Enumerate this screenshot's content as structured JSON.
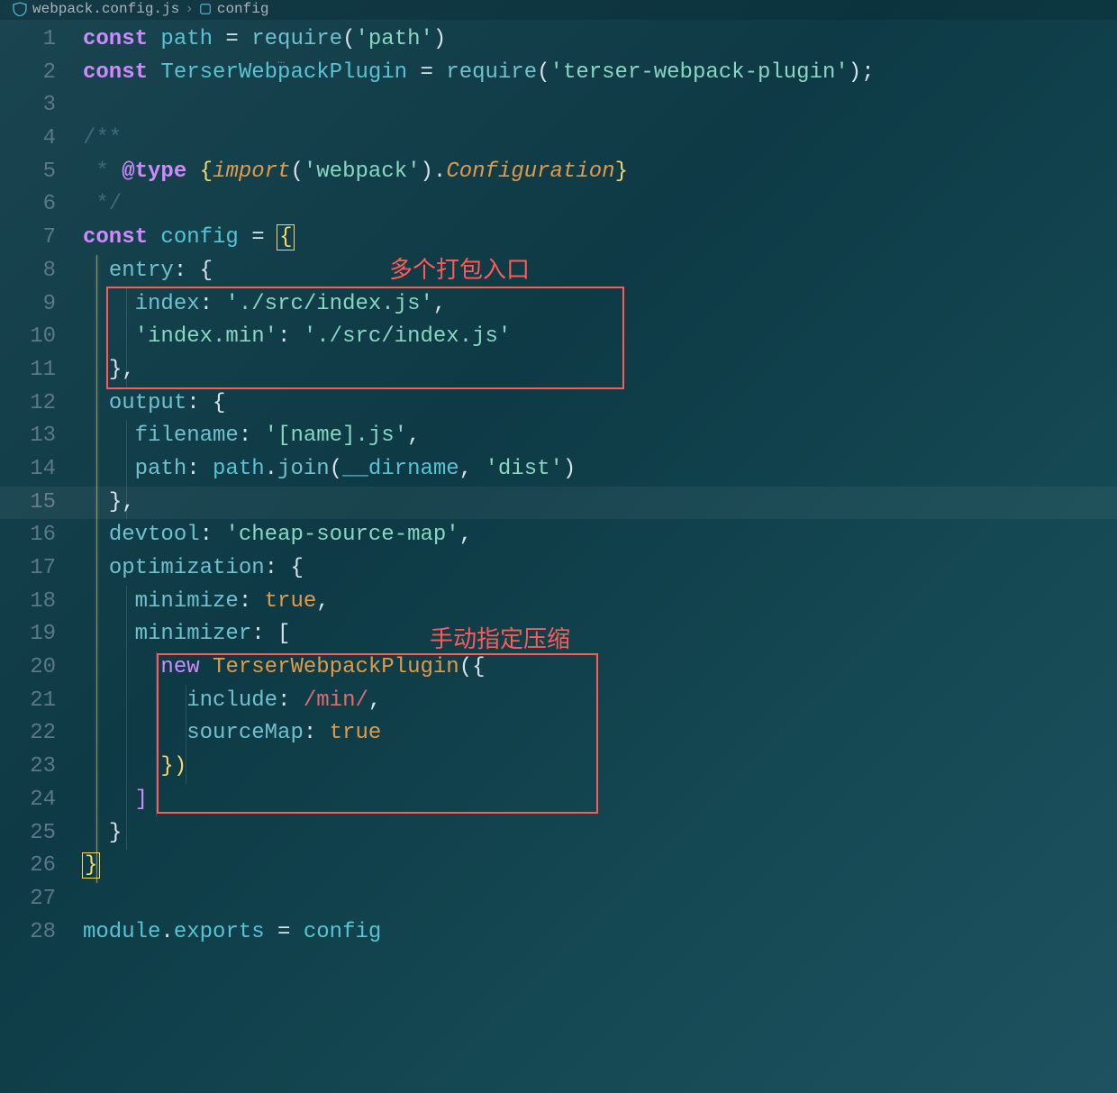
{
  "breadcrumb": {
    "file": "webpack.config.js",
    "symbol": "config"
  },
  "annotations": {
    "label1": "多个打包入口",
    "label2": "手动指定压缩"
  },
  "lineNumbers": [
    "1",
    "2",
    "3",
    "4",
    "5",
    "6",
    "7",
    "8",
    "9",
    "10",
    "11",
    "12",
    "13",
    "14",
    "15",
    "16",
    "17",
    "18",
    "19",
    "20",
    "21",
    "22",
    "23",
    "24",
    "25",
    "26",
    "27",
    "28"
  ],
  "tokens": {
    "const": "const",
    "path": "path",
    "eq": " = ",
    "require": "require",
    "lp": "(",
    "rp": ")",
    "q": "'",
    "s_path": "path",
    "s_terser": "terser-webpack-plugin",
    "Terser": "TerserWebpackPlugin",
    "semi": ";",
    "jd_open": "/**",
    "jd_star": " * ",
    "jd_attype": "@type",
    "jd_space": " ",
    "jd_lbrace": "{",
    "jd_import": "import",
    "jd_s_webpack": "webpack",
    "jd_dot": ".",
    "jd_Configuration": "Configuration",
    "jd_rbrace": "}",
    "jd_close": " */",
    "config": "config",
    "lbrace": "{",
    "rbrace": "}",
    "lbr_y": "{",
    "rbr_y": "}",
    "entry": "entry",
    "colon": ":",
    "sp": " ",
    "index": "index",
    "s_srcindex": "./src/index.js",
    "s_indexmin": "index.min",
    "comma": ",",
    "output": "output",
    "filename": "filename",
    "s_namejs": "[name].js",
    "pathkey": "path",
    "join": "join",
    "dirname": "__dirname",
    "s_dist": "dist",
    "devtool": "devtool",
    "s_cheap": "cheap-source-map",
    "optimization": "optimization",
    "minimize": "minimize",
    "true": "true",
    "minimizer": "minimizer",
    "lbracket": "[",
    "rbracket": "]",
    "new": "new",
    "include": "include",
    "re_min": "/min/",
    "sourceMap": "sourceMap",
    "module": "module",
    "exports": "exports",
    "dot": ".",
    "ellipsis": "…"
  }
}
